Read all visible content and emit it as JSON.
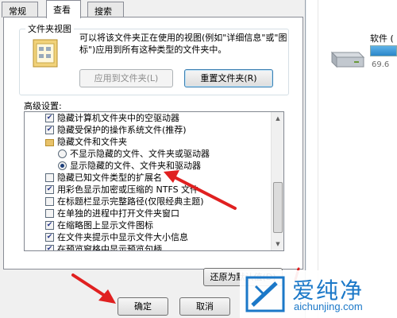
{
  "tabs": [
    "常规",
    "查看",
    "搜索"
  ],
  "folder_views": {
    "group_title": "文件夹视图",
    "description": "可以将该文件夹正在使用的视图(例如\"详细信息\"或\"图标\")应用到所有这种类型的文件夹中。",
    "apply_button": "应用到文件夹(L)",
    "reset_button": "重置文件夹(R)"
  },
  "advanced": {
    "label": "高级设置:",
    "items": [
      {
        "type": "checkbox",
        "checked": true,
        "label": "隐藏计算机文件夹中的空驱动器"
      },
      {
        "type": "checkbox",
        "checked": true,
        "label": "隐藏受保护的操作系统文件(推荐)"
      },
      {
        "type": "folder",
        "label": "隐藏文件和文件夹"
      },
      {
        "type": "radio",
        "checked": false,
        "label": "不显示隐藏的文件、文件夹或驱动器"
      },
      {
        "type": "radio",
        "checked": true,
        "label": "显示隐藏的文件、文件夹和驱动器"
      },
      {
        "type": "checkbox",
        "checked": false,
        "label": "隐藏已知文件类型的扩展名"
      },
      {
        "type": "checkbox",
        "checked": true,
        "label": "用彩色显示加密或压缩的 NTFS 文件"
      },
      {
        "type": "checkbox",
        "checked": false,
        "label": "在标题栏显示完整路径(仅限经典主题)"
      },
      {
        "type": "checkbox",
        "checked": false,
        "label": "在单独的进程中打开文件夹窗口"
      },
      {
        "type": "checkbox",
        "checked": true,
        "label": "在缩略图上显示文件图标"
      },
      {
        "type": "checkbox",
        "checked": true,
        "label": "在文件夹提示中显示文件大小信息"
      },
      {
        "type": "checkbox",
        "checked": true,
        "label": "在预览窗格中显示预览句柄"
      }
    ],
    "restore_button": "还原为默认值(D)"
  },
  "footer": {
    "ok_button": "确定",
    "cancel_button": "取消"
  },
  "explorer": {
    "drive_label": "软件 (",
    "drive_size": "69.6"
  },
  "watermark": {
    "name": "爱纯净",
    "url": "aichunjing.com"
  },
  "colors": {
    "arrow": "#e02020",
    "watermark": "#1b78c8"
  }
}
